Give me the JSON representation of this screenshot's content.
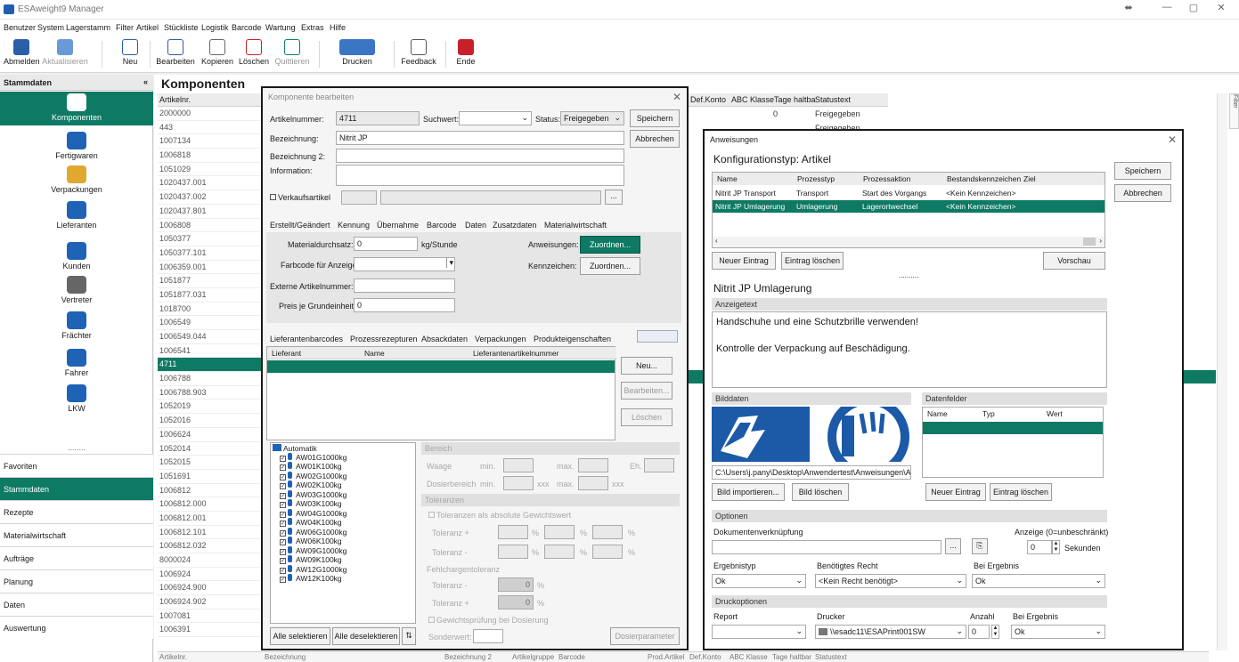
{
  "app": {
    "title": "ESAweight9 Manager"
  },
  "menu": [
    "Benutzer",
    "System",
    "Lagerstamm",
    "Filter",
    "Artikel",
    "Stückliste",
    "Logistik",
    "Barcode",
    "Wartung",
    "Extras",
    "Hilfe"
  ],
  "toolbar": {
    "abmelden": "Abmelden",
    "aktualisieren": "Aktualisieren",
    "neu": "Neu",
    "bearbeiten": "Bearbeiten",
    "kopieren": "Kopieren",
    "loeschen": "Löschen",
    "quittieren": "Quittieren",
    "drucken": "Drucken",
    "feedback": "Feedback",
    "ende": "Ende"
  },
  "sidebar": {
    "title": "Stammdaten",
    "collapse": "«",
    "items": [
      "Komponenten",
      "Fertigwaren",
      "Verpackungen",
      "Lieferanten",
      "Kunden",
      "Vertreter",
      "Frächter",
      "Fahrer",
      "LKW"
    ],
    "more": "........",
    "sections": [
      "Favoriten",
      "Stammdaten",
      "Rezepte",
      "Materialwirtschaft",
      "Aufträge",
      "Planung",
      "Daten",
      "Auswertung"
    ]
  },
  "main": {
    "title": "Komponenten",
    "col_artikelnr": "Artikelnr.",
    "rows": [
      "2000000",
      "443",
      "1007134",
      "1006818",
      "1051029",
      "1020437.001",
      "1020437.002",
      "1020437.801",
      "1006808",
      "1050377",
      "1050377.101",
      "1006359.001",
      "1051877",
      "1051877.031",
      "1018700",
      "1006549",
      "1006549.044",
      "1006541",
      "4711",
      "1006788",
      "1006788.903",
      "1052019",
      "1052016",
      "1006624",
      "1052014",
      "1052015",
      "1051691",
      "1006812",
      "1006812.000",
      "1006812.001",
      "1006812.101",
      "1006812.032",
      "8000024",
      "1006924",
      "1006924.900",
      "1006924.902",
      "1007081",
      "1006391"
    ],
    "grid2": {
      "defkonto": "Def.Konto",
      "abc": "ABC Klasse",
      "tage": "Tage haltba",
      "status": "Statustext",
      "row1": {
        "tage": "0",
        "status": "Freigegeben"
      },
      "row2": {
        "status": "Freigegeben"
      }
    },
    "footer": [
      "Artikelnr.",
      "Bezeichnung",
      "Bezeichnung 2",
      "Artikelgruppe",
      "Barcode",
      "Prod.Artikel",
      "Def.Konto",
      "ABC Klasse",
      "Tage haltbar",
      "Statustext"
    ],
    "filter_tab": "Filter"
  },
  "komp": {
    "title": "Komponente bearbeiten",
    "artikelnummer_lbl": "Artikelnummer:",
    "artikelnummer": "4711",
    "suchwert_lbl": "Suchwert:",
    "status_lbl": "Status:",
    "status": "Freigegeben",
    "bezeichnung_lbl": "Bezeichnung:",
    "bezeichnung": "Nitrit JP",
    "bezeichnung2_lbl": "Bezeichnung 2:",
    "information_lbl": "Information:",
    "verkaufsartikel_lbl": "Verkaufsartikel",
    "speichern": "Speichern",
    "abbrechen": "Abbrechen",
    "tabs": [
      "Erstellt/Geändert",
      "Kennung",
      "Übernahme",
      "Barcode",
      "Daten",
      "Zusatzdaten",
      "Materialwirtschaft"
    ],
    "materialdurchsatz_lbl": "Materialdurchsatz:",
    "materialdurchsatz": "0",
    "materialdurchsatz_unit": "kg/Stunde",
    "farbcode_lbl": "Farbcode für Anzeige:",
    "externe_lbl": "Externe Artikelnummer:",
    "preis_lbl": "Preis je Grundeinheit:",
    "preis": "0",
    "anweisungen_lbl": "Anweisungen:",
    "kennzeichen_lbl": "Kennzeichen:",
    "zuordnen": "Zuordnen...",
    "tabs2": [
      "Lieferantenbarcodes",
      "Prozessrezepturen",
      "Absackdaten",
      "Verpackungen",
      "Produkteigenschaften"
    ],
    "lief_cols": [
      "Lieferant",
      "Name",
      "Lieferantenartikelnummer"
    ],
    "neu": "Neu...",
    "bearbeiten": "Bearbeiten...",
    "loeschen": "Löschen",
    "tree": {
      "root": "Automatik",
      "items": [
        "AW01G1000kg",
        "AW01K100kg",
        "AW02G1000kg",
        "AW02K100kg",
        "AW03G1000kg",
        "AW03K100kg",
        "AW04G1000kg",
        "AW04K100kg",
        "AW06G1000kg",
        "AW06K100kg",
        "AW09G1000kg",
        "AW09K100kg",
        "AW12G1000kg",
        "AW12K100kg"
      ]
    },
    "alle_sel": "Alle selektieren",
    "alle_desel": "Alle deselektieren",
    "bereich": "Bereich",
    "waage": "Waage",
    "min": "min.",
    "max": "max.",
    "eh": "Eh.",
    "dosierbereich": "Dosierbereich",
    "xxx": "xxx",
    "toleranzen": "Toleranzen",
    "tol_abs": "Toleranzen als absolute Gewichtswert",
    "tol_plus": "Toleranz +",
    "tol_minus": "Toleranz -",
    "pct": "%",
    "fehlcharge": "Fehlchargentoleranz",
    "fc_minus": "Toleranz -",
    "fc_plus": "Toleranz +",
    "fc_val": "0",
    "gewichtspruefung": "Gewichtsprüfung bei Dosierung",
    "sonderwert": "Sonderwert:",
    "dosierparameter": "Dosierparameter"
  },
  "anw": {
    "title": "Anweisungen",
    "konfig": "Konfigurationstyp: Artikel",
    "speichern": "Speichern",
    "abbrechen": "Abbrechen",
    "cols": [
      "Name",
      "Prozesstyp",
      "Prozessaktion",
      "Bestandskennzeichen",
      "Ziel"
    ],
    "rows": [
      [
        "Nitrit JP Transport",
        "Transport",
        "Start des Vorgangs",
        "<Kein Kennzeichen>"
      ],
      [
        "Nitrit JP Umlagerung",
        "Umlagerung",
        "Lagerortwechsel",
        "<Kein Kennzeichen>"
      ]
    ],
    "neuer_eintrag": "Neuer Eintrag",
    "eintrag_loeschen": "Eintrag löschen",
    "vorschau": "Vorschau",
    "dots": "..........",
    "subtitle": "Nitrit JP Umlagerung",
    "anzeigetext": "Anzeigetext",
    "text1": "Handschuhe und eine Schutzbrille verwenden!",
    "text2": "Kontrolle der Verpackung auf Beschädigung.",
    "bilddaten": "Bilddaten",
    "datenfelder": "Datenfelder",
    "df_cols": [
      "Name",
      "Typ",
      "Wert"
    ],
    "path": "C:\\Users\\j.pany\\Desktop\\Anwendertest\\Anweisungen\\Ar",
    "bild_import": "Bild importieren...",
    "bild_loeschen": "Bild löschen",
    "optionen": "Optionen",
    "dokument": "Dokumentenverknüpfung",
    "anzeige": "Anzeige (0=unbeschränkt)",
    "anzeige_val": "0",
    "sekunden": "Sekunden",
    "ergebnistyp": "Ergebnistyp",
    "ergebnistyp_val": "Ok",
    "recht": "Benötigtes Recht",
    "recht_val": "<Kein Recht benötigt>",
    "bei_ergebnis": "Bei Ergebnis",
    "bei_ergebnis_val": "Ok",
    "druckoptionen": "Druckoptionen",
    "report": "Report",
    "drucker": "Drucker",
    "drucker_val": "\\\\esadc11\\ESAPrint001SW",
    "anzahl": "Anzahl",
    "anzahl_val": "0",
    "bei_ergebnis2": "Bei Ergebnis",
    "bei_ergebnis2_val": "Ok"
  },
  "colors": {
    "accent": "#0e7a63",
    "blue": "#1e63b5",
    "danger": "#c8202a"
  }
}
